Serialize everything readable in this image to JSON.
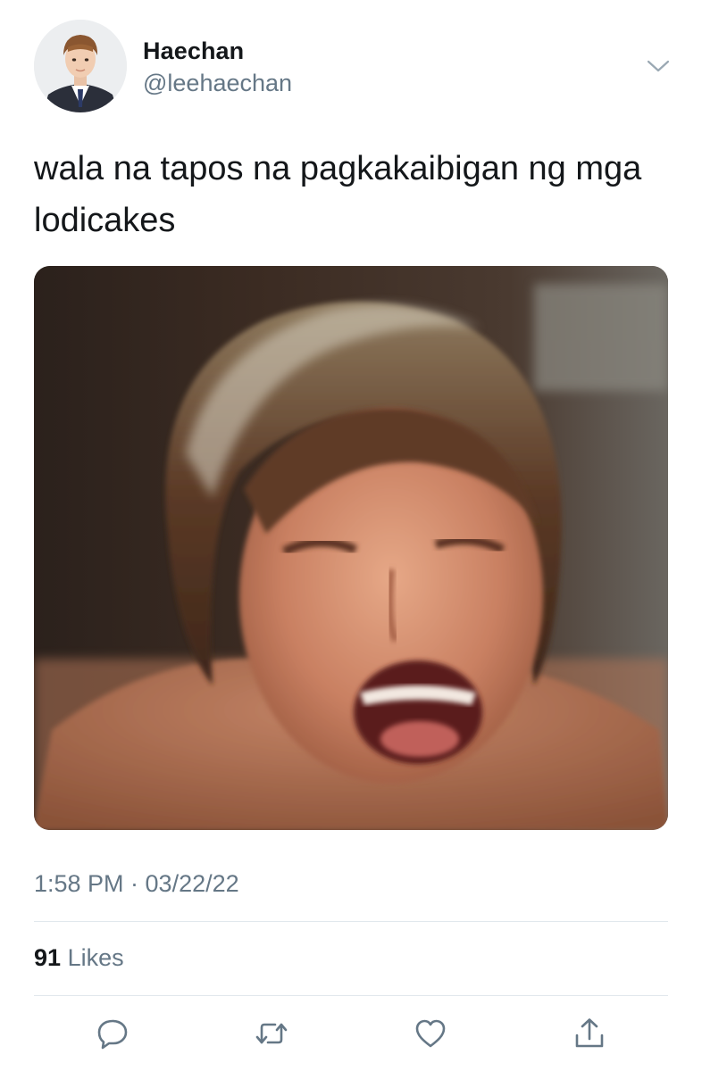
{
  "author": {
    "display_name": "Haechan",
    "handle": "@leehaechan"
  },
  "tweet": {
    "text": "wala na tapos na pagkakaibigan ng mga lodicakes",
    "timestamp": "1:58 PM · 03/22/22"
  },
  "stats": {
    "likes_count": "91",
    "likes_label": "Likes"
  },
  "icons": {
    "caret": "chevron-down-icon",
    "reply": "reply-icon",
    "retweet": "retweet-icon",
    "like": "heart-icon",
    "share": "share-icon"
  },
  "colors": {
    "text": "#14171a",
    "secondary": "#657786",
    "divider": "#e1e8ed",
    "icon": "#657786"
  }
}
